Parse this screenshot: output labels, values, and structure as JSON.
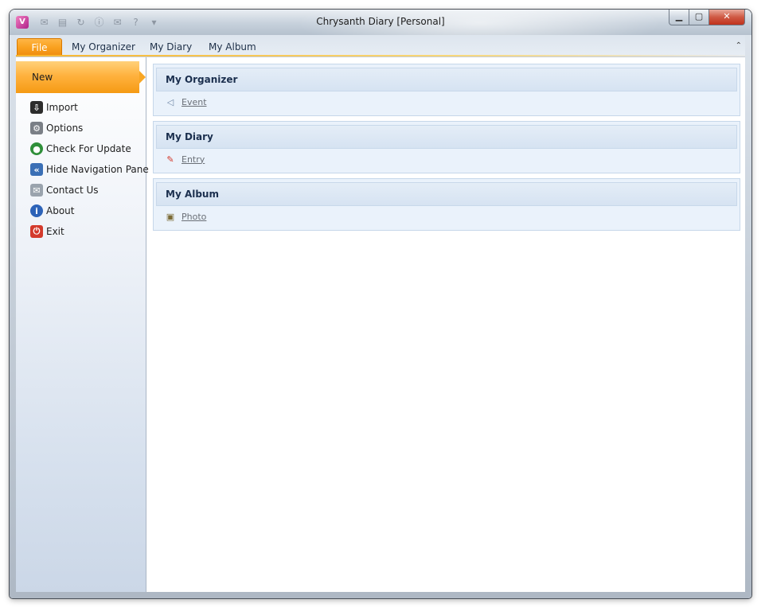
{
  "window": {
    "title": "Chrysanth Diary [Personal]",
    "minimize_glyph": "▁",
    "maximize_glyph": "▢",
    "close_glyph": "✕",
    "collapse_glyph": "⌃",
    "logo_glyph": "V"
  },
  "quick_access_toolbar": [
    {
      "icon": "event-icon",
      "glyph": "✉"
    },
    {
      "icon": "diary-icon",
      "glyph": "▤"
    },
    {
      "icon": "refresh-icon",
      "glyph": "↻"
    },
    {
      "icon": "info-icon",
      "glyph": "ⓘ"
    },
    {
      "icon": "mail-icon",
      "glyph": "✉"
    },
    {
      "icon": "help-icon",
      "glyph": "?"
    },
    {
      "icon": "customize-dropdown-icon",
      "glyph": "▾"
    }
  ],
  "tabs": [
    {
      "label": "File"
    },
    {
      "label": "My Organizer"
    },
    {
      "label": "My Diary"
    },
    {
      "label": "My Album"
    }
  ],
  "sidebar": {
    "selected": "New",
    "items": [
      {
        "label": "Import",
        "icon": "import-icon",
        "glyph": "⇩",
        "color": "#2c2c2c"
      },
      {
        "label": "Options",
        "icon": "gear-icon",
        "glyph": "⚙",
        "color": "#7a7f86"
      },
      {
        "label": "Check For Update",
        "icon": "globe-icon",
        "glyph": "●",
        "color": "#2f8f3a"
      },
      {
        "label": "Hide Navigation Pane",
        "icon": "collapse-pane-icon",
        "glyph": "«",
        "color": "#3a6fb5"
      },
      {
        "label": "Contact Us",
        "icon": "envelope-icon",
        "glyph": "✉",
        "color": "#9aa3ad"
      },
      {
        "label": "About",
        "icon": "info-icon",
        "glyph": "i",
        "color": "#2d63b8"
      },
      {
        "label": "Exit",
        "icon": "power-icon",
        "glyph": "⏻",
        "color": "#d33a2c"
      }
    ]
  },
  "groups": [
    {
      "title": "My Organizer",
      "link": "Event",
      "icon": "event-icon",
      "glyph": "◁"
    },
    {
      "title": "My Diary",
      "link": "Entry",
      "icon": "pencil-icon",
      "glyph": "✎"
    },
    {
      "title": "My Album",
      "link": "Photo",
      "icon": "photo-icon",
      "glyph": "▣"
    }
  ],
  "colors": {
    "accent": "#f9a01e",
    "group_header_text": "#1b2f4e",
    "link_text": "#6a6f76"
  }
}
